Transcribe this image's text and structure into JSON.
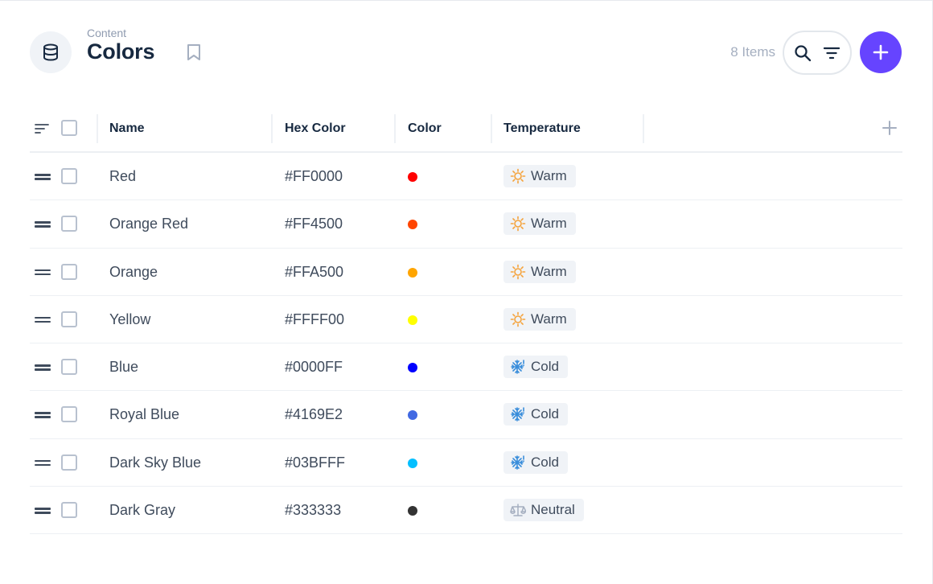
{
  "header": {
    "breadcrumb": "Content",
    "title": "Colors",
    "items_count": "8 Items"
  },
  "table": {
    "columns": [
      "Name",
      "Hex Color",
      "Color",
      "Temperature"
    ],
    "rows": [
      {
        "name": "Red",
        "hex": "#FF0000",
        "color": "#FF0000",
        "temperature": "Warm",
        "temp_icon": "sun-icon"
      },
      {
        "name": "Orange Red",
        "hex": "#FF4500",
        "color": "#FF4500",
        "temperature": "Warm",
        "temp_icon": "sun-icon"
      },
      {
        "name": "Orange",
        "hex": "#FFA500",
        "color": "#FFA500",
        "temperature": "Warm",
        "temp_icon": "sun-icon"
      },
      {
        "name": "Yellow",
        "hex": "#FFFF00",
        "color": "#FFFF00",
        "temperature": "Warm",
        "temp_icon": "sun-icon"
      },
      {
        "name": "Blue",
        "hex": "#0000FF",
        "color": "#0000FF",
        "temperature": "Cold",
        "temp_icon": "snowflake-icon"
      },
      {
        "name": "Royal Blue",
        "hex": "#4169E2",
        "color": "#4169E2",
        "temperature": "Cold",
        "temp_icon": "snowflake-icon"
      },
      {
        "name": "Dark Sky Blue",
        "hex": "#03BFFF",
        "color": "#03BFFF",
        "temperature": "Cold",
        "temp_icon": "snowflake-icon"
      },
      {
        "name": "Dark Gray",
        "hex": "#333333",
        "color": "#333333",
        "temperature": "Neutral",
        "temp_icon": "scale-icon"
      }
    ]
  },
  "colors": {
    "accent": "#6644FF",
    "text": "#172940",
    "muted": "#8F9BB0",
    "badge_bg": "#F0F3F7",
    "warm_icon": "#F5A33C",
    "cold_icon": "#3A8EDB",
    "neutral_icon": "#A5AFC0"
  }
}
